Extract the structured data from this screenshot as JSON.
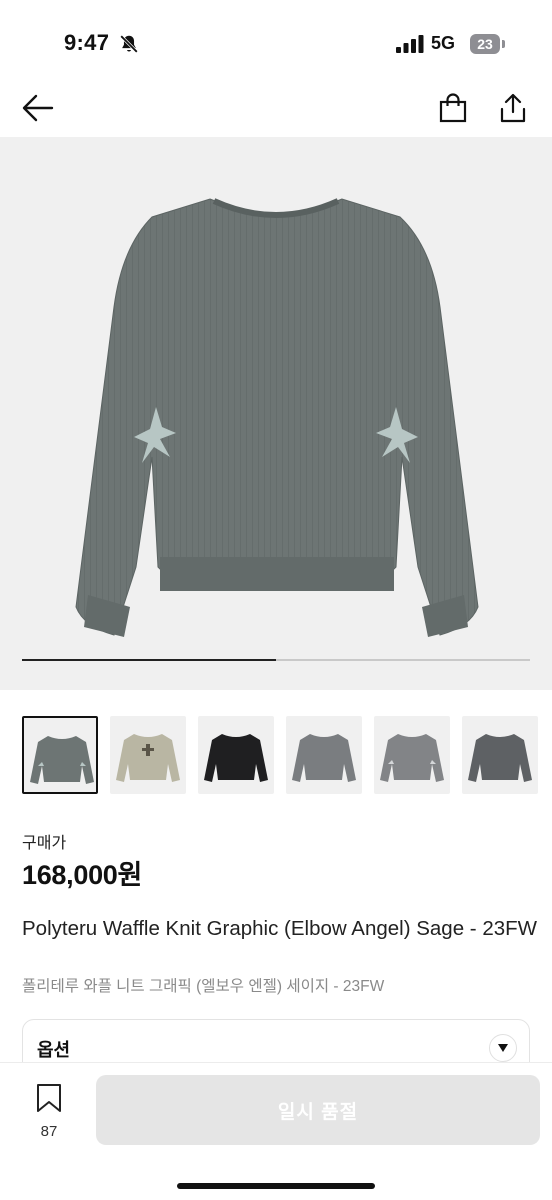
{
  "status_bar": {
    "time": "9:47",
    "network": "5G",
    "battery": "23",
    "icons": [
      "bell-slash-icon",
      "signal-icon",
      "battery-icon"
    ]
  },
  "nav": {
    "icons": [
      "back-arrow-icon",
      "shopping-bag-icon",
      "share-icon"
    ]
  },
  "gallery": {
    "progress": 0.5,
    "thumbnail_count": 6
  },
  "pricing": {
    "label": "구매가",
    "price": "168,000원"
  },
  "product": {
    "title": "Polyteru Waffle Knit Graphic (Elbow Angel) Sage - 23FW",
    "subtitle": "폴리테루 와플 니트 그래픽 (엘보우 엔젤) 세이지 - 23FW"
  },
  "option": {
    "label": "옵션",
    "icon": "chevron-down-icon"
  },
  "bottom_bar": {
    "bookmark_count": "87",
    "action_label": "일시 품절"
  },
  "colors": {
    "sweater": "#6d7574",
    "button_disabled": "#e5e5e5"
  }
}
